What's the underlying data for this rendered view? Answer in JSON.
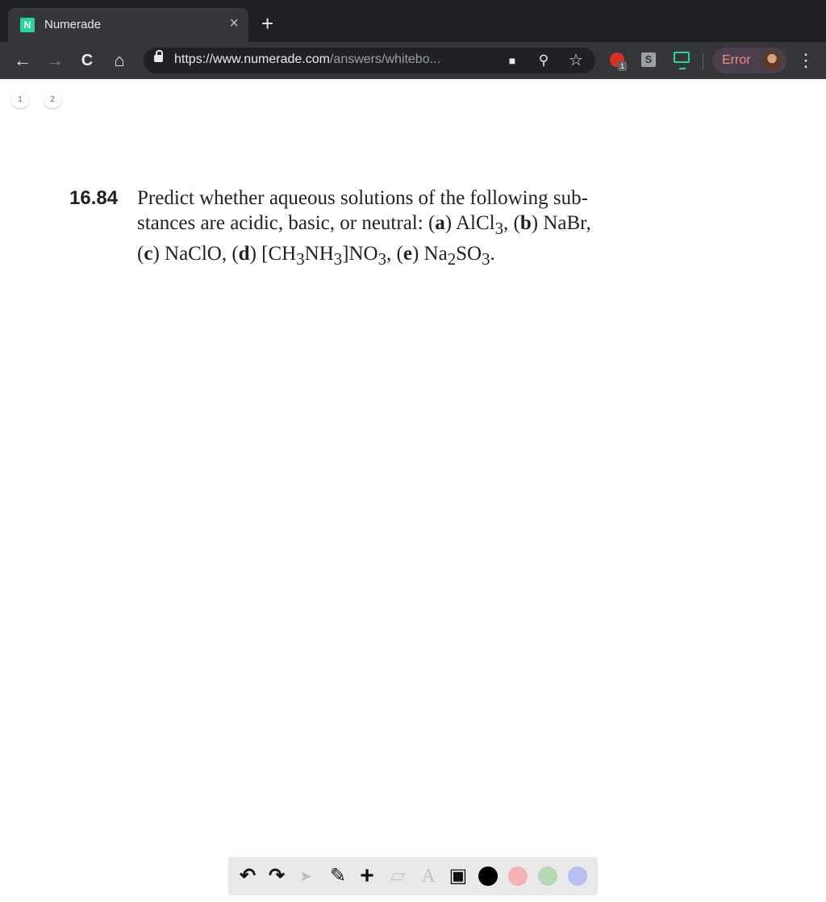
{
  "browser": {
    "tab_title": "Numerade",
    "favicon_letter": "N",
    "tab_close": "×",
    "new_tab": "+",
    "url_host": "https://www.numerade.com",
    "url_path": "/answers/whitebo...",
    "profile_label": "Error",
    "extension_badge": "1",
    "extension_s": "S",
    "accent_color": "#2ad39a"
  },
  "nav_icons": {
    "back": "←",
    "forward": "→",
    "reload": "C",
    "home": "⌂",
    "camera": "■",
    "zoom": "⚲",
    "star": "☆",
    "menu": "⋮"
  },
  "pages": [
    "1",
    "2"
  ],
  "problem": {
    "number": "16.84",
    "line1": "Predict whether aqueous solutions of the following sub-",
    "line2a": "stances are acidic, basic, or neutral: (",
    "a": "a",
    "line2b": ") AlCl",
    "sub3": "3",
    "line2c": ", (",
    "b": "b",
    "line2d": ") NaBr,",
    "line3a": "(",
    "c": "c",
    "line3b": ") NaClO, (",
    "d": "d",
    "line3c": ") [CH",
    "line3d": "NH",
    "line3e": "]NO",
    "line3f": ", (",
    "e": "e",
    "line3g": ") Na",
    "sub2": "2",
    "line3h": "SO",
    "line3i": "."
  },
  "whiteboard_tools": {
    "undo": "↶",
    "redo": "↷",
    "pointer": "➤",
    "pen": "✎",
    "add": "+",
    "eraser": "▱",
    "text": "A",
    "image": "▣",
    "colors": [
      "#000000",
      "#f4b3b3",
      "#b5d8b5",
      "#b7c0ef"
    ]
  }
}
